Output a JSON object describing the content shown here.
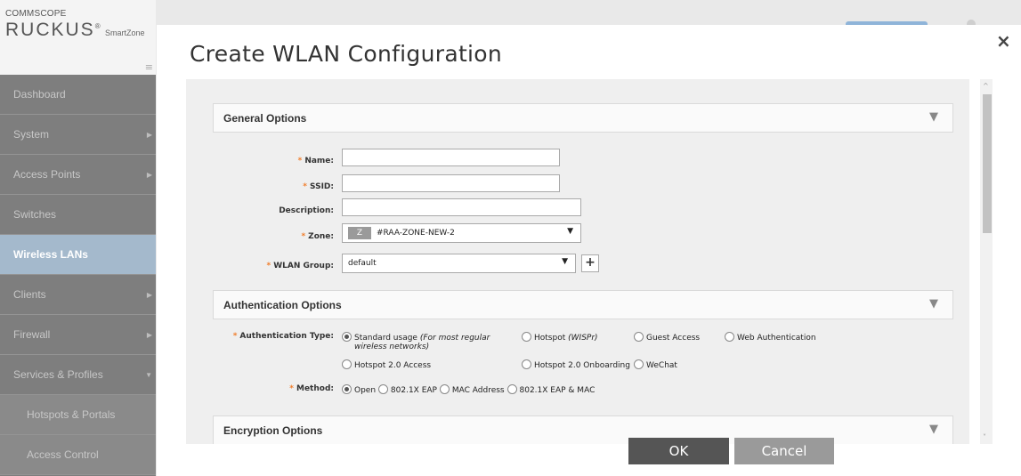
{
  "brand": {
    "company": "COMMSCOPE",
    "product": "RUCKUS",
    "registered": "®",
    "suffix": "SmartZone",
    "menu_toggle_icon": "hamburger-icon"
  },
  "sidebar": {
    "items": [
      {
        "label": "Dashboard",
        "arrow": ""
      },
      {
        "label": "System",
        "arrow": "▶"
      },
      {
        "label": "Access Points",
        "arrow": "▶"
      },
      {
        "label": "Switches",
        "arrow": ""
      },
      {
        "label": "Wireless LANs",
        "arrow": "",
        "active": true
      },
      {
        "label": "Clients",
        "arrow": "▶"
      },
      {
        "label": "Firewall",
        "arrow": "▶"
      },
      {
        "label": "Services & Profiles",
        "arrow": "▼"
      },
      {
        "label": "Hotspots & Portals",
        "arrow": ""
      },
      {
        "label": "Access Control",
        "arrow": ""
      }
    ]
  },
  "modal": {
    "title": "Create WLAN Configuration",
    "close": "×",
    "ok_label": "OK",
    "cancel_label": "Cancel"
  },
  "general": {
    "title": "General Options",
    "chevron": "▼",
    "required_mark": "*",
    "name_label": "Name:",
    "name_value": "",
    "ssid_label": "SSID:",
    "ssid_value": "",
    "description_label": "Description:",
    "description_value": "",
    "zone_label": "Zone:",
    "zone_badge": "Z",
    "zone_value": "#RAA-ZONE-NEW-2",
    "wlan_group_label": "WLAN Group:",
    "wlan_group_value": "default",
    "caret": "▼",
    "add": "+"
  },
  "authentication": {
    "title": "Authentication Options",
    "chevron": "▼",
    "type_label": "Authentication Type:",
    "standard": "Standard usage",
    "standard_note_a": "(For most regular",
    "standard_note_b": "wireless networks)",
    "hotspot": "Hotspot",
    "hotspot_note": "(WISPr)",
    "guest": "Guest Access",
    "web": "Web Authentication",
    "hs20": "Hotspot 2.0 Access",
    "hs20_onboarding": "Hotspot 2.0 Onboarding",
    "wechat": "WeChat",
    "method_label": "Method:",
    "m_open": "Open",
    "m_8021x": "802.1X EAP",
    "m_mac": "MAC Address",
    "m_8021x_mac": "802.1X EAP & MAC"
  },
  "encryption": {
    "title": "Encryption Options",
    "chevron": "▼"
  },
  "scroll": {
    "up": "^",
    "down": "˅"
  },
  "colors": {
    "accent_required": "#f07d2a",
    "sidebar_active": "#a4b9cc",
    "ok_button": "#555555",
    "cancel_button": "#9a9a9a"
  }
}
